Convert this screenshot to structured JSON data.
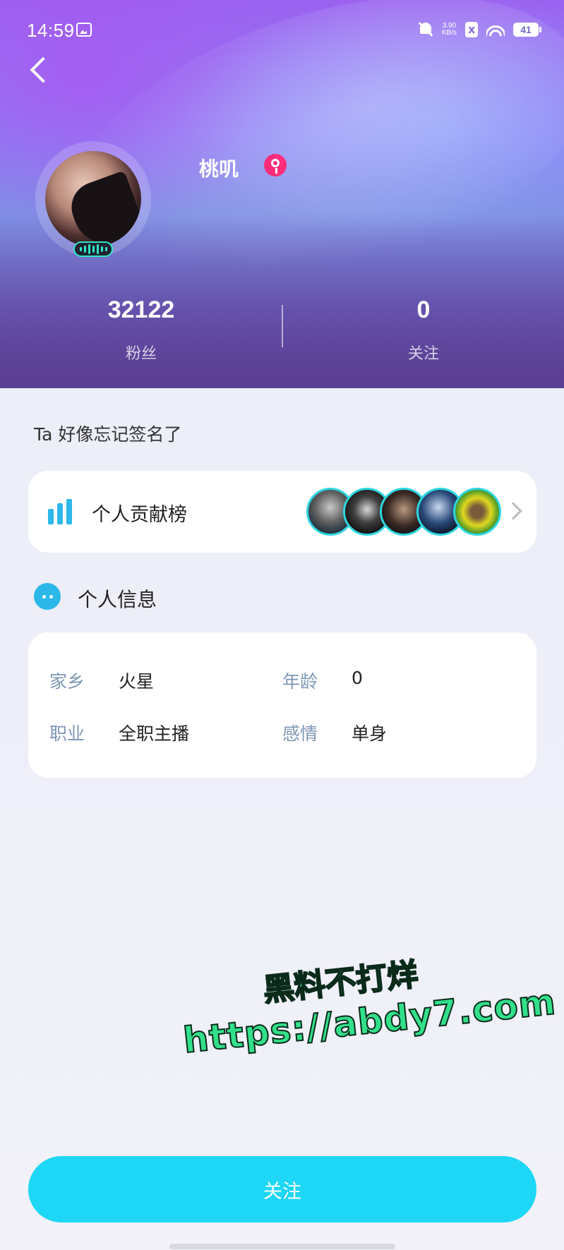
{
  "status_bar": {
    "time": "14:59",
    "net_speed_value": "3.90",
    "net_speed_unit": "KB/s",
    "battery": "41"
  },
  "profile": {
    "username": "桃叽",
    "gender_icon": "female-icon",
    "fans_count": "32122",
    "fans_label": "粉丝",
    "follow_count": "0",
    "follow_label": "关注",
    "signature": "Ta 好像忘记签名了"
  },
  "contribution": {
    "label": "个人贡献榜",
    "avatar_count": 5
  },
  "personal_info": {
    "title": "个人信息",
    "fields": [
      {
        "label": "家乡",
        "value": "火星"
      },
      {
        "label": "年龄",
        "value": "0"
      },
      {
        "label": "职业",
        "value": "全职主播"
      },
      {
        "label": "感情",
        "value": "单身"
      }
    ]
  },
  "watermark": {
    "line1": "黑料不打烊",
    "line2": "https://abdy7.com"
  },
  "actions": {
    "follow_button": "关注"
  },
  "colors": {
    "accent": "#1ed6f5",
    "info_label": "#7d96b4",
    "female_badge": "#ff2d7a",
    "watermark": "#33e08a"
  }
}
